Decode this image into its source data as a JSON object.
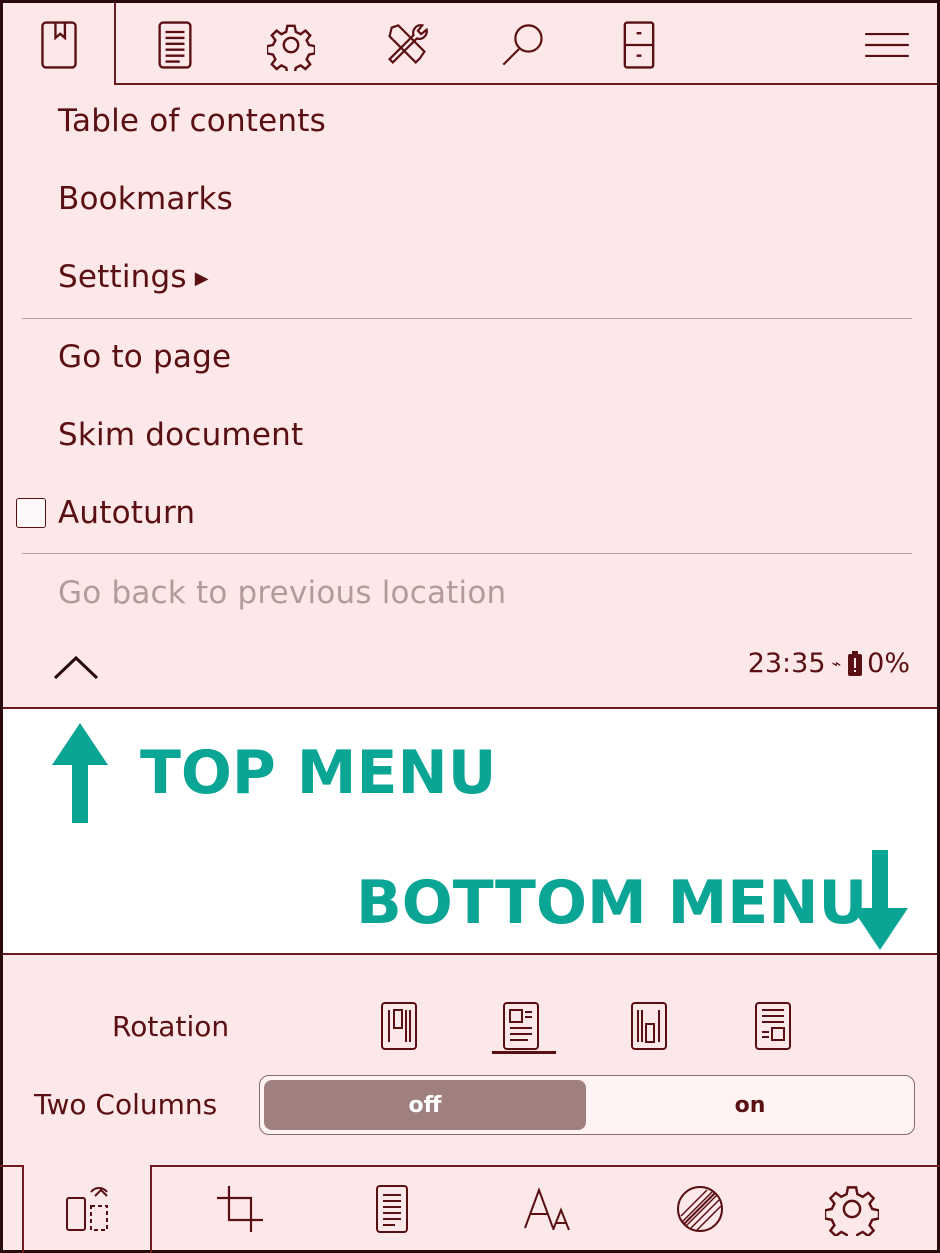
{
  "top_menu": {
    "tabs": [
      {
        "icon": "book-icon"
      },
      {
        "icon": "document-icon"
      },
      {
        "icon": "gear-icon"
      },
      {
        "icon": "tools-icon"
      },
      {
        "icon": "search-icon"
      },
      {
        "icon": "cabinet-icon"
      },
      {
        "icon": "hamburger-menu-icon"
      }
    ],
    "items": {
      "toc": "Table of contents",
      "bookmarks": "Bookmarks",
      "settings": "Settings",
      "go_to_page": "Go to page",
      "skim": "Skim document",
      "autoturn": "Autoturn",
      "go_back": "Go back to previous location"
    },
    "autoturn_checked": false,
    "status": {
      "time": "23:35",
      "battery": "0%"
    }
  },
  "annotations": {
    "top": "TOP MENU",
    "bottom": "BOTTOM MENU",
    "color": "#0aa595"
  },
  "bottom_menu": {
    "rotation_label": "Rotation",
    "two_columns_label": "Two Columns",
    "toggle": {
      "off": "off",
      "on": "on",
      "selected": "off"
    },
    "rotation_selected_index": 1,
    "tabs": [
      {
        "icon": "page-rotate-icon"
      },
      {
        "icon": "crop-icon"
      },
      {
        "icon": "document-icon"
      },
      {
        "icon": "font-size-icon"
      },
      {
        "icon": "contrast-icon"
      },
      {
        "icon": "gear-icon"
      }
    ]
  },
  "colors": {
    "panel_bg": "#fce8e8",
    "ink": "#5a0f12",
    "disabled": "#b59a9a",
    "toggle_selected": "#a07f7f"
  }
}
